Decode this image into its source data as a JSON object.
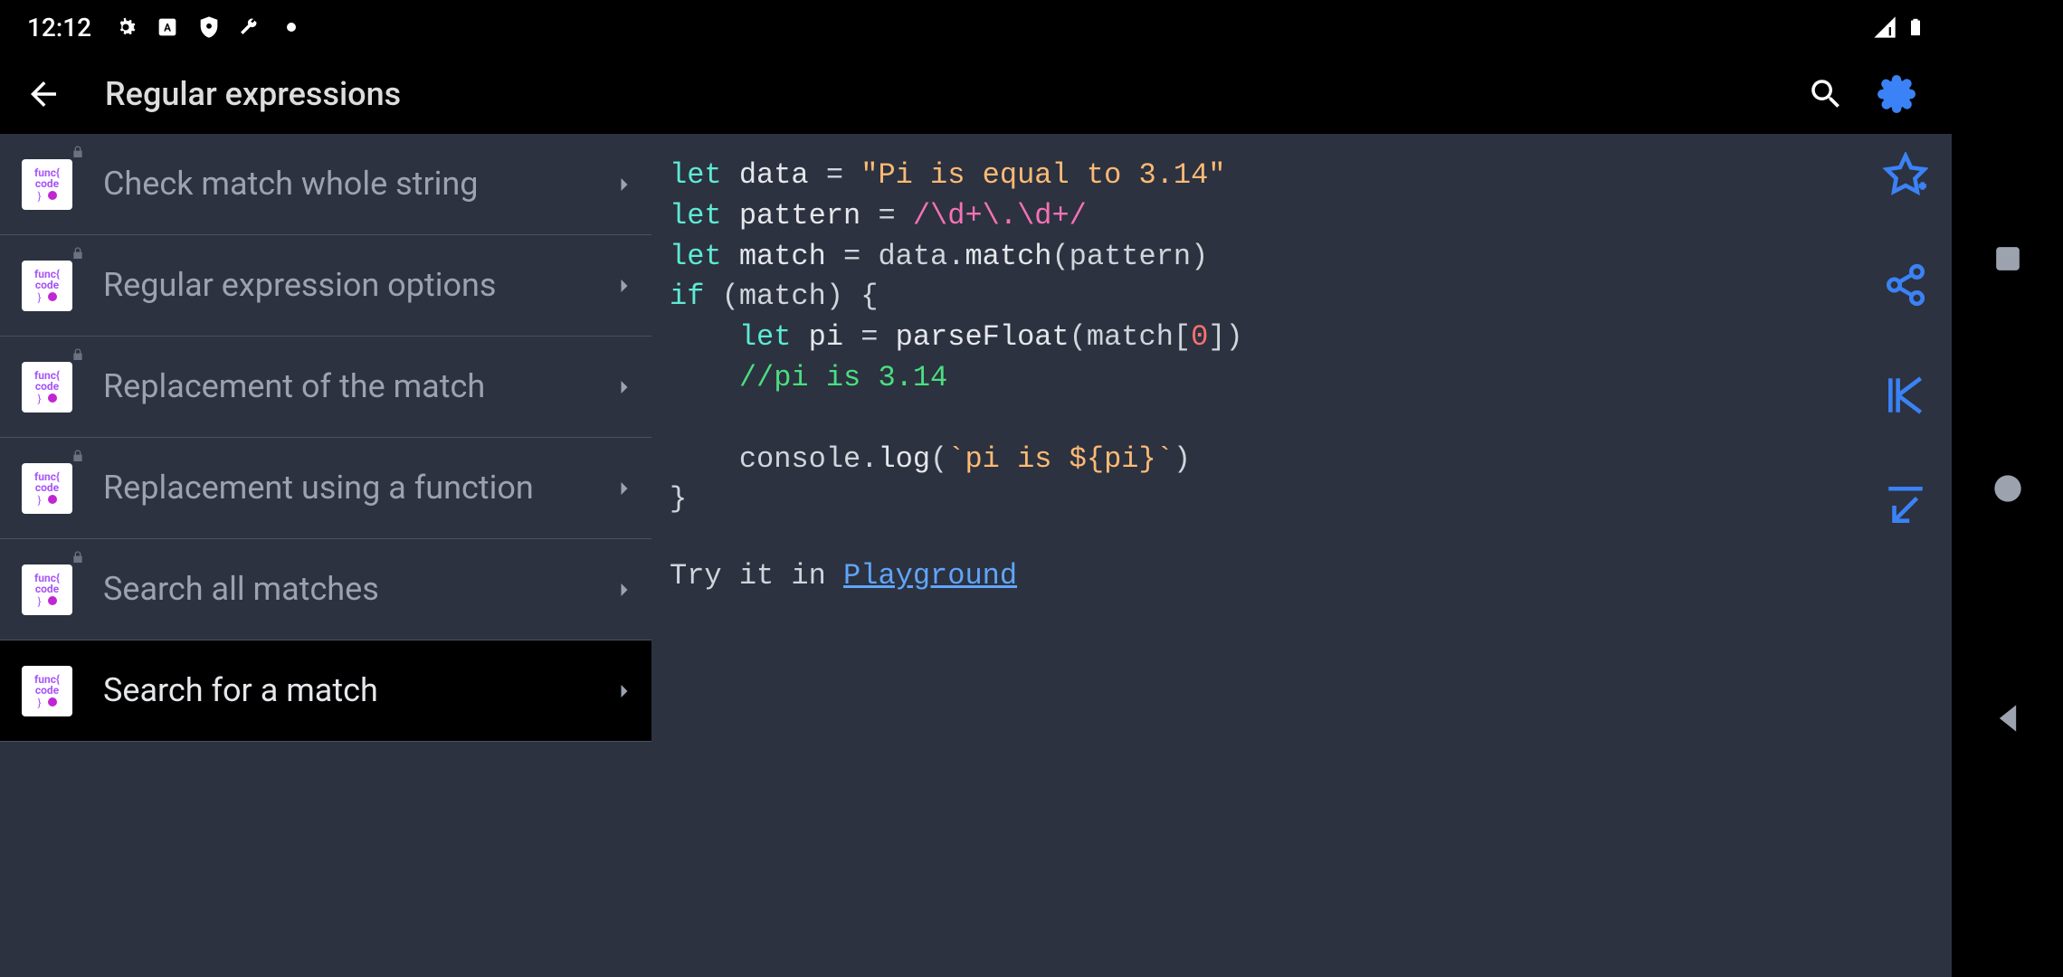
{
  "status": {
    "time": "12:12"
  },
  "header": {
    "title": "Regular expressions"
  },
  "sidebar": {
    "items": [
      {
        "label": "Check match whole string",
        "locked": true,
        "selected": false
      },
      {
        "label": "Regular expression options",
        "locked": true,
        "selected": false
      },
      {
        "label": "Replacement of the match",
        "locked": true,
        "selected": false
      },
      {
        "label": "Replacement using a function",
        "locked": true,
        "selected": false
      },
      {
        "label": "Search all matches",
        "locked": true,
        "selected": false
      },
      {
        "label": "Search for a match",
        "locked": false,
        "selected": true
      }
    ]
  },
  "code": {
    "l1": {
      "kw": "let",
      "var": "data",
      "op": "=",
      "str": "\"Pi is equal to 3.14\""
    },
    "l2": {
      "kw": "let",
      "var": "pattern",
      "op": "=",
      "regex": "/\\d+\\.\\d+/"
    },
    "l3": {
      "kw": "let",
      "var": "match",
      "op": "=",
      "expr_a": "data.",
      "expr_b": "match",
      "expr_c": "(pattern)"
    },
    "l4": {
      "kw": "if",
      "cond": "(match) {"
    },
    "l5": {
      "kw": "let",
      "var": "pi",
      "op": "=",
      "fn": "parseFloat",
      "args": "(match[",
      "num": "0",
      "args2": "])"
    },
    "l6": {
      "cmt": "//pi is 3.14"
    },
    "l7": {
      "obj": "console.",
      "fn": "log",
      "open": "(",
      "tmpl": "`pi is ${pi}`",
      "close": ")"
    },
    "l8": {
      "brace": "}"
    }
  },
  "try": {
    "prefix": "Try it in ",
    "link": "Playground"
  }
}
